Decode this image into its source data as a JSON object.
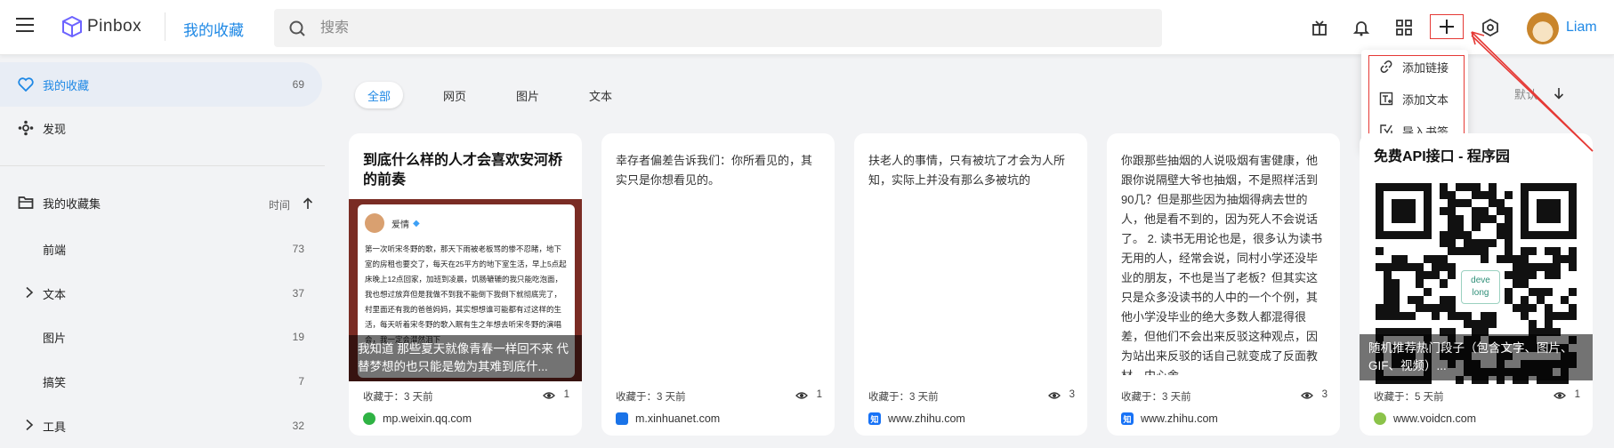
{
  "header": {
    "logo_text": "Pinbox",
    "title": "我的收藏",
    "search_placeholder": "搜索",
    "username": "Liam",
    "icons": [
      "gift-icon",
      "bell-icon",
      "apps-grid-icon",
      "plus-icon",
      "settings-icon"
    ]
  },
  "dropdown": {
    "items": [
      {
        "label": "添加链接",
        "icon": "link-icon"
      },
      {
        "label": "添加文本",
        "icon": "add-text-icon"
      },
      {
        "label": "导入书签",
        "icon": "import-bookmark-icon"
      }
    ]
  },
  "sidebar": {
    "my_collections": {
      "label": "我的收藏",
      "count": "69"
    },
    "discover": {
      "label": "发现"
    },
    "collection_sets": {
      "label": "我的收藏集",
      "sort_label": "时间"
    },
    "sets": [
      {
        "label": "前端",
        "count": "73"
      },
      {
        "label": "文本",
        "count": "37"
      },
      {
        "label": "图片",
        "count": "19"
      },
      {
        "label": "搞笑",
        "count": "7"
      },
      {
        "label": "工具",
        "count": "32"
      }
    ]
  },
  "filters": {
    "tabs": [
      "全部",
      "网页",
      "图片",
      "文本"
    ],
    "default_sort": "默认"
  },
  "cards": [
    {
      "title": "到底什么样的人才会喜欢安河桥的前奏",
      "image_author": "爱情",
      "image_text": "第一次听宋冬野的歌，那天下雨被老板骂的惨不忍睹，地下室的房租也要交了，每天在25平方的地下室生活，早上5点起床晚上12点回家，加班到凌晨，饥肠辘辘的我只能吃泡面，我也想过放弃但是我做不到我不能倒下我倒下就彻底完了，村里面还有我的爸爸妈妈，其实想想谁可能都有过这样的生活，每天听着宋冬野的歌入眠有生之年想去听宋冬野的演唱会，我一定会潸然泪下",
      "overlay": "我知道 那些夏天就像青春一样回不来 代替梦想的也只能是勉为其难到底什...",
      "time": "收藏于：3 天前",
      "views": "1",
      "domain": "mp.weixin.qq.com"
    },
    {
      "text": "幸存者偏差告诉我们：你所看见的，其实只是你想看见的。",
      "time": "收藏于：3 天前",
      "views": "1",
      "domain": "m.xinhuanet.com"
    },
    {
      "text": "扶老人的事情，只有被坑了才会为人所知，实际上并没有那么多被坑的",
      "time": "收藏于：3 天前",
      "views": "3",
      "domain": "www.zhihu.com"
    },
    {
      "text": "你跟那些抽烟的人说吸烟有害健康，他跟你说隔壁大爷也抽烟，不是照样活到90几？但是那些因为抽烟得病去世的人，他是看不到的，因为死人不会说话了。 2. 读书无用论也是，很多认为读书无用的人，经常会说，同村小学还没毕业的朋友，不也是当了老板？但其实这只是众多没读书的人中的一个个例，其他小学没毕业的绝大多数人都混得很差，但他们不会出来反驳这种观点，因为站出来反驳的话自己就变成了反面教材，内心舍",
      "time": "收藏于：3 天前",
      "views": "3",
      "domain": "www.zhihu.com"
    },
    {
      "title": "免费API接口 - 程序园",
      "qr_badge": "deve long",
      "overlay": "随机推荐热门段子（包含文字、图片、GIF、视频）...",
      "time": "收藏于：5 天前",
      "views": "1",
      "domain": "www.voidcn.com"
    }
  ],
  "colors": {
    "accent": "#1e88e5",
    "annotation_red": "#e53935"
  }
}
